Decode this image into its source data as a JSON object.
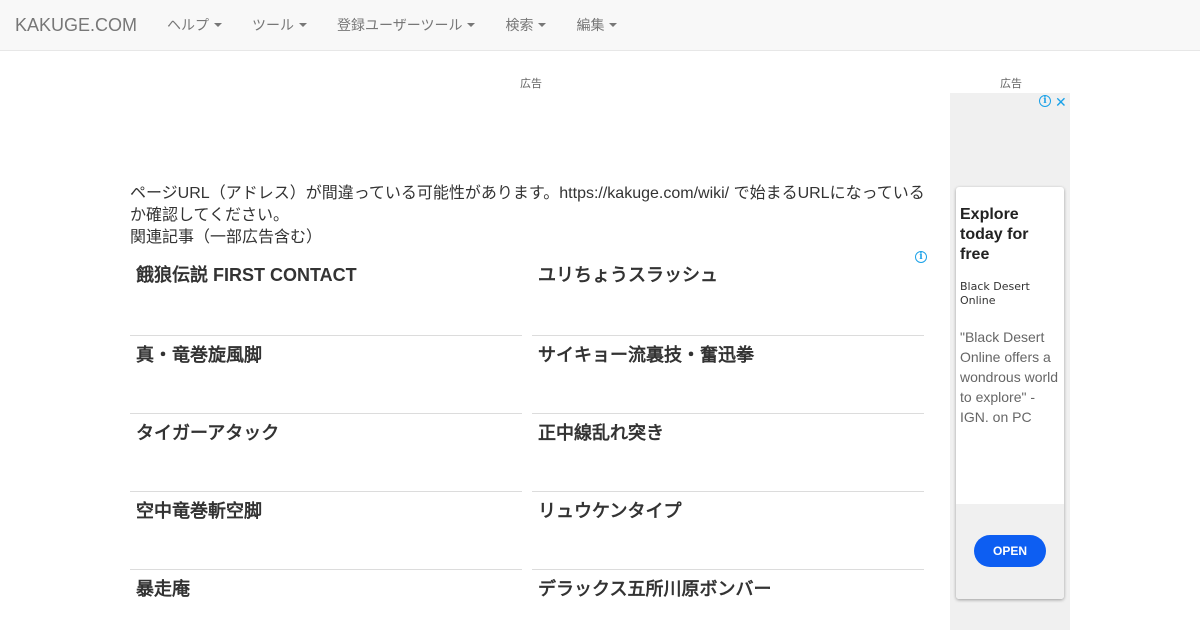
{
  "navbar": {
    "brand": "KAKUGE.COM",
    "items": [
      {
        "label": "ヘルプ"
      },
      {
        "label": "ツール"
      },
      {
        "label": "登録ユーザーツール"
      },
      {
        "label": "検索"
      },
      {
        "label": "編集"
      }
    ]
  },
  "ads": {
    "main_label": "広告",
    "side_label": "広告"
  },
  "content": {
    "notice": "ページURL（アドレス）が間違っている可能性があります。https://kakuge.com/wiki/ で始まるURLになっているか確認してください。",
    "related_title": "関連記事（一部広告含む）",
    "related_items": [
      {
        "label": "餓狼伝説 FIRST CONTACT"
      },
      {
        "label": "ユリちょうスラッシュ"
      },
      {
        "label": "真・竜巻旋風脚"
      },
      {
        "label": "サイキョー流裏技・奮迅拳"
      },
      {
        "label": "タイガーアタック"
      },
      {
        "label": "正中線乱れ突き"
      },
      {
        "label": "空中竜巻斬空脚"
      },
      {
        "label": "リュウケンタイプ"
      },
      {
        "label": "暴走庵"
      },
      {
        "label": "デラックス五所川原ボンバー"
      }
    ]
  },
  "side_ad": {
    "headline": "Explore today for free",
    "advertiser": "Black Desert Online",
    "body": "\"Black Desert Online offers a wondrous world to explore\" - IGN. on PC",
    "cta": "OPEN",
    "close_glyph": "✕",
    "adchoices_glyph": "i"
  },
  "colors": {
    "navbar_bg": "#f8f8f8",
    "cta_blue": "#0d5ef2",
    "adchoices_blue": "#1aa1e8"
  }
}
